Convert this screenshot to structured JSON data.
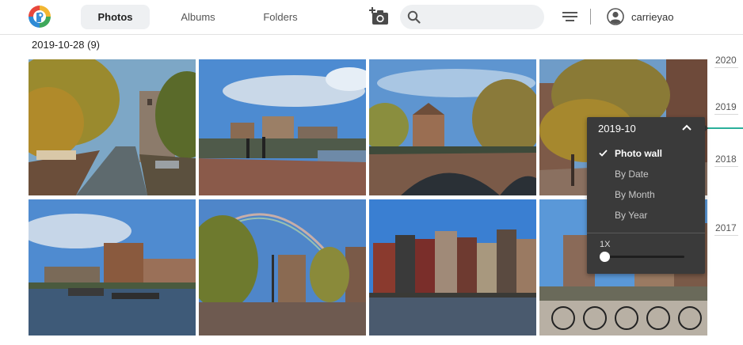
{
  "app": {
    "logo_icon": "app-logo"
  },
  "nav": {
    "tabs": [
      {
        "label": "Photos",
        "active": true
      },
      {
        "label": "Albums",
        "active": false
      },
      {
        "label": "Folders",
        "active": false
      }
    ]
  },
  "toolbar": {
    "add_photo_icon": "camera-plus-icon",
    "search_icon": "search-icon",
    "search_value": "",
    "filter_icon": "filter-icon",
    "user_icon": "user-circle-icon",
    "username": "carrieyao"
  },
  "content": {
    "date_heading": "2019-10-28 (9)",
    "photos": [
      {
        "subject": "canal-autumn-trees"
      },
      {
        "subject": "bridge-cyclists"
      },
      {
        "subject": "arched-bridge"
      },
      {
        "subject": "street-trees"
      },
      {
        "subject": "canal-boats-reflection"
      },
      {
        "subject": "rainbow-street"
      },
      {
        "subject": "canal-houses-reflection"
      },
      {
        "subject": "bicycles-on-bridge"
      }
    ]
  },
  "timeline": {
    "years": [
      "2020",
      "2019",
      "2018",
      "2017"
    ],
    "current_year": "2019",
    "accent_color": "#2bb09b"
  },
  "view_menu": {
    "current": "2019-10",
    "items": [
      {
        "label": "Photo wall",
        "selected": true
      },
      {
        "label": "By Date",
        "selected": false
      },
      {
        "label": "By Month",
        "selected": false
      },
      {
        "label": "By Year",
        "selected": false
      }
    ],
    "zoom_label": "1X",
    "zoom_fraction": 0
  }
}
